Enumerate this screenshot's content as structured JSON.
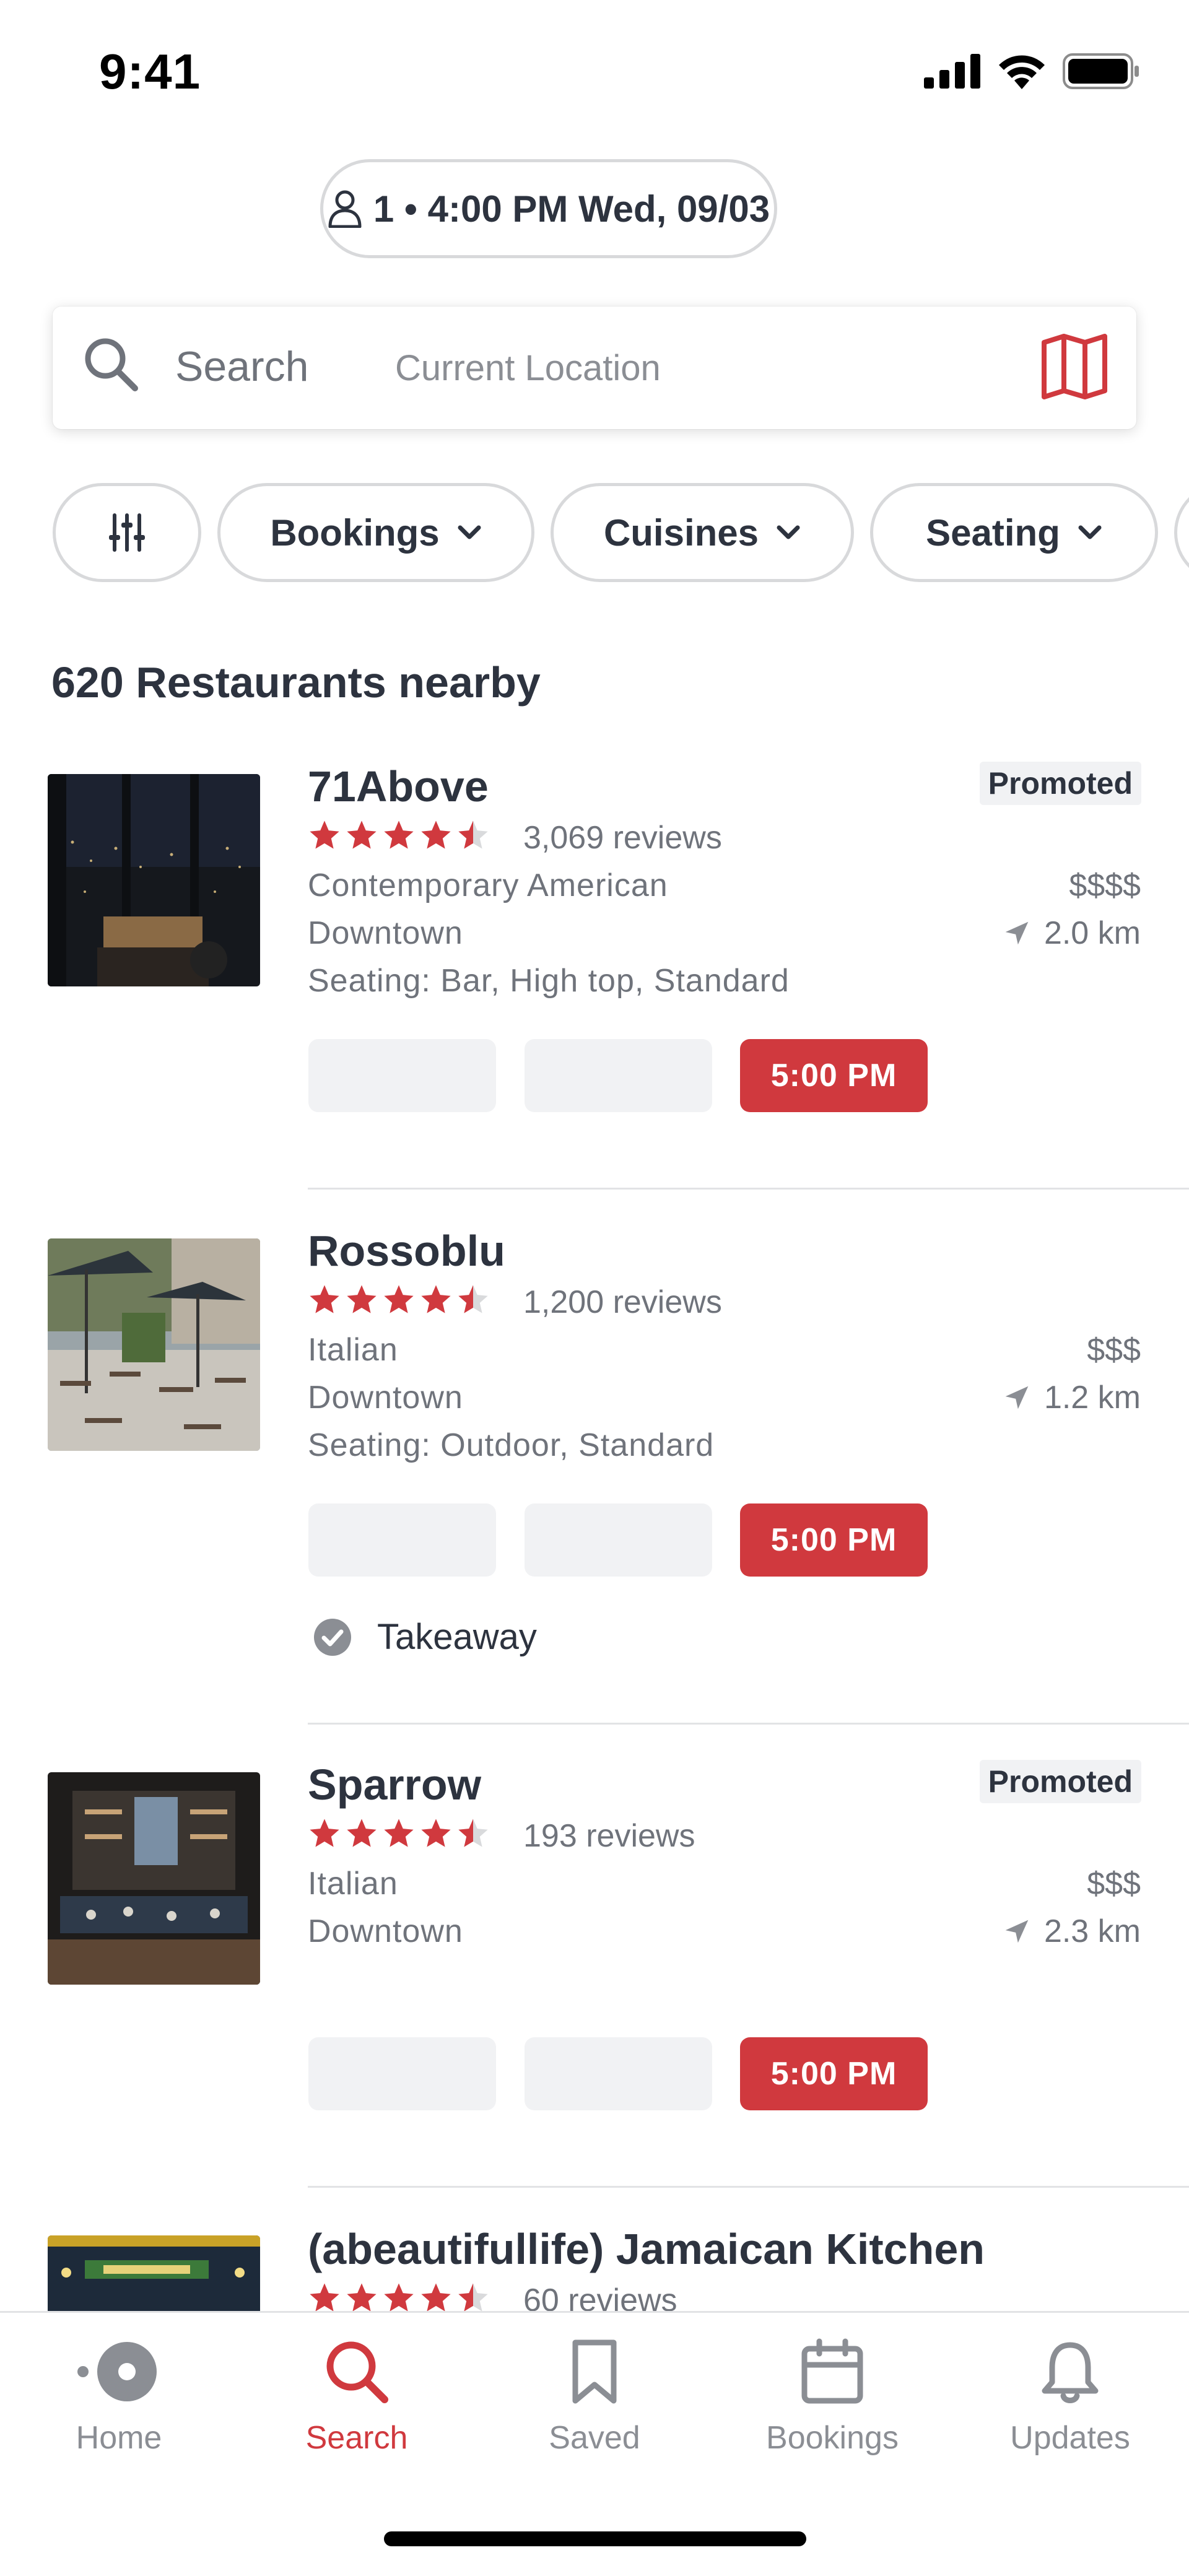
{
  "status_bar": {
    "time": "9:41"
  },
  "party": {
    "label": "1 • 4:00 PM Wed, 09/03"
  },
  "search": {
    "label": "Search",
    "location": "Current Location"
  },
  "filters": [
    {
      "label": "Bookings"
    },
    {
      "label": "Cuisines"
    },
    {
      "label": "Seating"
    }
  ],
  "results_header": "620 Restaurants nearby",
  "restaurants": [
    {
      "name": "71Above",
      "promoted": "Promoted",
      "rating": 4.5,
      "reviews": "3,069 reviews",
      "cuisine": "Contemporary American",
      "price": "$$$$",
      "neighborhood": "Downtown",
      "distance": "2.0 km",
      "seating": "Seating: Bar, High top, Standard",
      "time_slot": "5:00 PM"
    },
    {
      "name": "Rossoblu",
      "rating": 4.5,
      "reviews": "1,200 reviews",
      "cuisine": "Italian",
      "price": "$$$",
      "neighborhood": "Downtown",
      "distance": "1.2 km",
      "seating": "Seating: Outdoor, Standard",
      "time_slot": "5:00 PM",
      "takeaway": "Takeaway"
    },
    {
      "name": "Sparrow",
      "promoted": "Promoted",
      "rating": 4.5,
      "reviews": "193 reviews",
      "cuisine": "Italian",
      "price": "$$$",
      "neighborhood": "Downtown",
      "distance": "2.3 km",
      "time_slot": "5:00 PM"
    },
    {
      "name": "(abeautifullife) Jamaican Kitchen",
      "rating": 4.5,
      "reviews": "60 reviews"
    }
  ],
  "tabs": [
    {
      "label": "Home",
      "icon": "home-icon"
    },
    {
      "label": "Search",
      "icon": "search-icon",
      "active": true
    },
    {
      "label": "Saved",
      "icon": "bookmark-icon"
    },
    {
      "label": "Bookings",
      "icon": "calendar-icon"
    },
    {
      "label": "Updates",
      "icon": "bell-icon"
    }
  ],
  "colors": {
    "accent": "#d0393e",
    "text": "#2d333f",
    "muted": "#6f737b"
  }
}
